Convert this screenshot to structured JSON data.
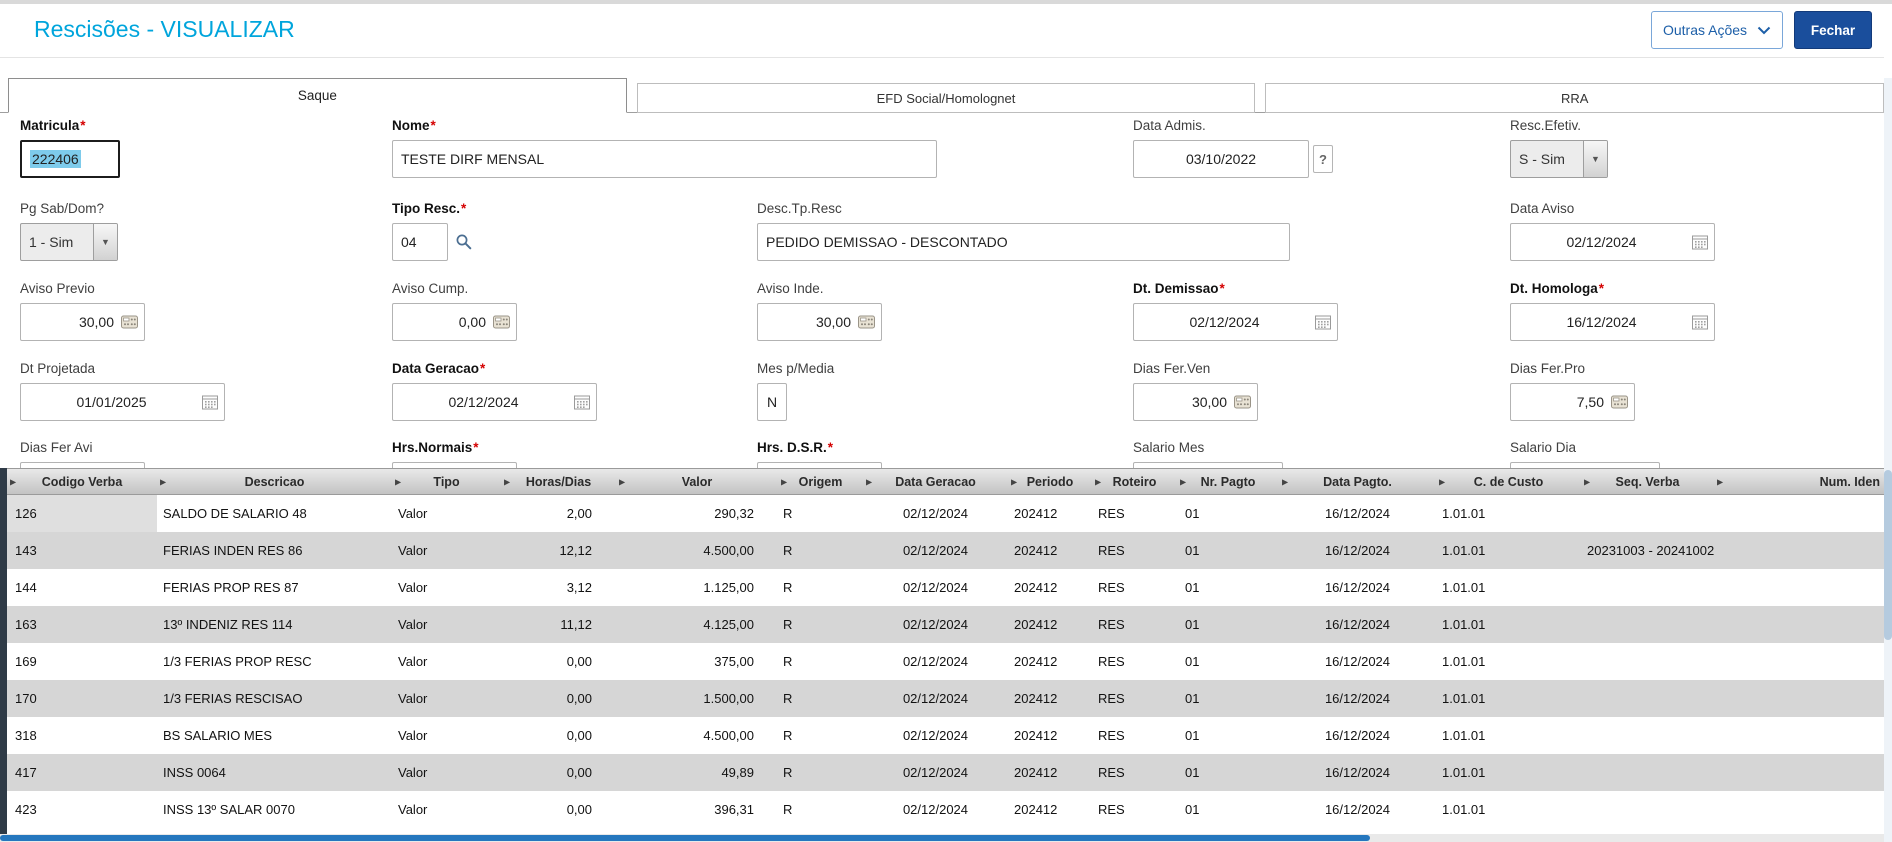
{
  "colors": {
    "accent": "#00A5DC",
    "primary_btn": "#1A4E9C",
    "secondary_btn_text": "#1D5FA8",
    "selection": "#7ECBEB",
    "stripe": "#D6D6D6",
    "scroll_thumb": "#2577BE",
    "required": "#D40000"
  },
  "header": {
    "title": "Rescisões - VISUALIZAR",
    "other_actions": "Outras Ações",
    "close": "Fechar"
  },
  "tabs": {
    "saque": "Saque",
    "efd": "EFD Social/Homolognet",
    "rra": "RRA"
  },
  "icons": {
    "dropdown": "▼",
    "help": "?",
    "chevron_down": "⌄"
  },
  "form": {
    "fields": {
      "matricula": {
        "label": "Matricula",
        "req": "*",
        "value": "222406"
      },
      "nome": {
        "label": "Nome",
        "req": "*",
        "value": "TESTE DIRF MENSAL"
      },
      "data_admis": {
        "label": "Data Admis.",
        "value": "03/10/2022"
      },
      "resc_efetiv": {
        "label": "Resc.Efetiv.",
        "value": "S - Sim"
      },
      "pg_sabdom": {
        "label": "Pg Sab/Dom?",
        "value": "1 - Sim"
      },
      "tipo_resc": {
        "label": "Tipo Resc.",
        "req": "*",
        "value": "04"
      },
      "desc_tp_resc": {
        "label": "Desc.Tp.Resc",
        "value": "PEDIDO DEMISSAO - DESCONTADO"
      },
      "data_aviso": {
        "label": "Data Aviso",
        "value": "02/12/2024"
      },
      "aviso_previo": {
        "label": "Aviso Previo",
        "value": "30,00"
      },
      "aviso_cump": {
        "label": "Aviso Cump.",
        "value": "0,00"
      },
      "aviso_inde": {
        "label": "Aviso Inde.",
        "value": "30,00"
      },
      "dt_demissao": {
        "label": "Dt. Demissao",
        "req": "*",
        "value": "02/12/2024"
      },
      "dt_homologa": {
        "label": "Dt. Homologa",
        "req": "*",
        "value": "16/12/2024"
      },
      "dt_projetada": {
        "label": "Dt Projetada",
        "value": "01/01/2025"
      },
      "data_geracao": {
        "label": "Data Geracao",
        "req": "*",
        "value": "02/12/2024"
      },
      "mes_pmedia": {
        "label": "Mes p/Media",
        "value": "N"
      },
      "dias_fer_ven": {
        "label": "Dias Fer.Ven",
        "value": "30,00"
      },
      "dias_fer_pro": {
        "label": "Dias Fer.Pro",
        "value": "7,50"
      },
      "dias_fer_avi": {
        "label": "Dias Fer Avi",
        "value": ""
      },
      "hrs_normais": {
        "label": "Hrs.Normais",
        "req": "*",
        "value": ""
      },
      "hrs_dsr": {
        "label": "Hrs. D.S.R.",
        "req": "*",
        "value": ""
      },
      "salario_mes": {
        "label": "Salario Mes",
        "value": ""
      },
      "salario_dia": {
        "label": "Salario Dia",
        "value": ""
      }
    }
  },
  "grid": {
    "marker": "▶",
    "columns": [
      "Codigo Verba",
      "Descricao",
      "Tipo",
      "Horas/Dias",
      "Valor",
      "Origem",
      "Data Geracao",
      "Periodo",
      "Roteiro",
      "Nr. Pagto",
      "Data Pagto.",
      "C. de Custo",
      "Seq. Verba",
      "Num. Iden"
    ],
    "selected_cell": {
      "row": 0,
      "col": 0
    },
    "rows": [
      [
        "126",
        "SALDO DE SALARIO 48",
        "Valor",
        "2,00",
        "290,32",
        "R",
        "02/12/2024",
        "202412",
        "RES",
        "01",
        "16/12/2024",
        "1.01.01",
        "",
        ""
      ],
      [
        "143",
        "FERIAS INDEN RES 86",
        "Valor",
        "12,12",
        "4.500,00",
        "R",
        "02/12/2024",
        "202412",
        "RES",
        "01",
        "16/12/2024",
        "1.01.01",
        "20231003 - 20241002",
        ""
      ],
      [
        "144",
        "FERIAS PROP RES 87",
        "Valor",
        "3,12",
        "1.125,00",
        "R",
        "02/12/2024",
        "202412",
        "RES",
        "01",
        "16/12/2024",
        "1.01.01",
        "",
        ""
      ],
      [
        "163",
        "13º INDENIZ RES 114",
        "Valor",
        "11,12",
        "4.125,00",
        "R",
        "02/12/2024",
        "202412",
        "RES",
        "01",
        "16/12/2024",
        "1.01.01",
        "",
        ""
      ],
      [
        "169",
        "1/3 FERIAS PROP RESC",
        "Valor",
        "0,00",
        "375,00",
        "R",
        "02/12/2024",
        "202412",
        "RES",
        "01",
        "16/12/2024",
        "1.01.01",
        "",
        ""
      ],
      [
        "170",
        "1/3 FERIAS RESCISAO",
        "Valor",
        "0,00",
        "1.500,00",
        "R",
        "02/12/2024",
        "202412",
        "RES",
        "01",
        "16/12/2024",
        "1.01.01",
        "",
        ""
      ],
      [
        "318",
        "BS SALARIO MES",
        "Valor",
        "0,00",
        "4.500,00",
        "R",
        "02/12/2024",
        "202412",
        "RES",
        "01",
        "16/12/2024",
        "1.01.01",
        "",
        ""
      ],
      [
        "417",
        "INSS 0064",
        "Valor",
        "0,00",
        "49,89",
        "R",
        "02/12/2024",
        "202412",
        "RES",
        "01",
        "16/12/2024",
        "1.01.01",
        "",
        ""
      ],
      [
        "423",
        "INSS 13º SALAR 0070",
        "Valor",
        "0,00",
        "396,31",
        "R",
        "02/12/2024",
        "202412",
        "RES",
        "01",
        "16/12/2024",
        "1.01.01",
        "",
        ""
      ]
    ]
  }
}
